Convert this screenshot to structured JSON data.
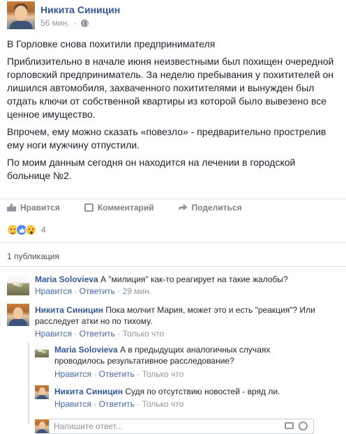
{
  "post": {
    "author": "Никита Синицин",
    "time": "56 мин.",
    "title": "В Горловке снова похитили предпринимателя",
    "paragraphs": [
      "Приблизительно в начале июня неизвестными был похищен очередной горловский предприниматель. За неделю пребывания у похитителей он лишился автомобиля, захваченного похитителями и вынужден был отдать ключи от собственной квартиры из которой было вывезено все ценное имущество.",
      "Впрочем, ему можно сказать «повезло» - предварительно прострелив ему ноги мужчину отпустили.",
      "По моим данным сегодня он находится на лечении в городской больнице №2."
    ]
  },
  "actions": {
    "like": "Нравится",
    "comment": "Комментарий",
    "share": "Поделиться"
  },
  "reactions": {
    "count": "4",
    "icons": [
      "sad-reaction-icon",
      "like-reaction-icon",
      "wow-reaction-icon"
    ]
  },
  "shares": "1 публикация",
  "comments": [
    {
      "author": "Maria Solovieva",
      "text": "А \"милиция\" как-то реагирует на такие жалобы?",
      "like": "Нравится",
      "reply": "Ответить",
      "time": "29 мин."
    },
    {
      "author": "Никита Синицин",
      "text": "Пока молчит Мария, может это и есть \"реакция\"? Или расследует атки но по тихому.",
      "like": "Нравится",
      "reply": "Ответить",
      "time": "Только что"
    }
  ],
  "replies": [
    {
      "author": "Maria Solovieva",
      "text": "А в предыдущих аналогичных случаях проводилось результативное расследование?",
      "like": "Нравится",
      "reply": "Ответить",
      "time": "Только что"
    },
    {
      "author": "Никита Синицин",
      "text": "Судя по отсутствию новостей - вряд ли.",
      "like": "Нравится",
      "reply": "Ответить",
      "time": "Только что"
    }
  ],
  "reply_input": {
    "placeholder": "Напишите ответ..."
  },
  "colors": {
    "link": "#365899",
    "muted": "#90949c"
  }
}
